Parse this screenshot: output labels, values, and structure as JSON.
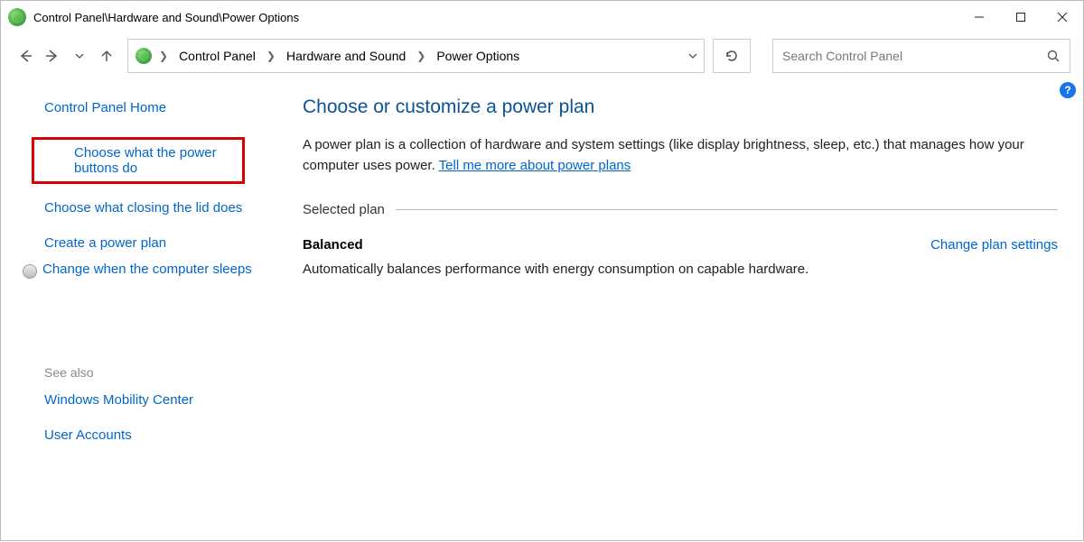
{
  "window": {
    "title": "Control Panel\\Hardware and Sound\\Power Options"
  },
  "breadcrumbs": {
    "0": "Control Panel",
    "1": "Hardware and Sound",
    "2": "Power Options"
  },
  "search": {
    "placeholder": "Search Control Panel"
  },
  "sidebar": {
    "home": "Control Panel Home",
    "links": {
      "0": "Choose what the power buttons do",
      "1": "Choose what closing the lid does",
      "2": "Create a power plan",
      "3": "Change when the computer sleeps"
    },
    "see_also_label": "See also",
    "see_also": {
      "0": "Windows Mobility Center",
      "1": "User Accounts"
    }
  },
  "main": {
    "heading": "Choose or customize a power plan",
    "description_pre": "A power plan is a collection of hardware and system settings (like display brightness, sleep, etc.) that manages how your computer uses power. ",
    "description_link": "Tell me more about power plans",
    "section_label": "Selected plan",
    "plan": {
      "name": "Balanced",
      "change_link": "Change plan settings",
      "description": "Automatically balances performance with energy consumption on capable hardware."
    },
    "help_icon": "?"
  }
}
